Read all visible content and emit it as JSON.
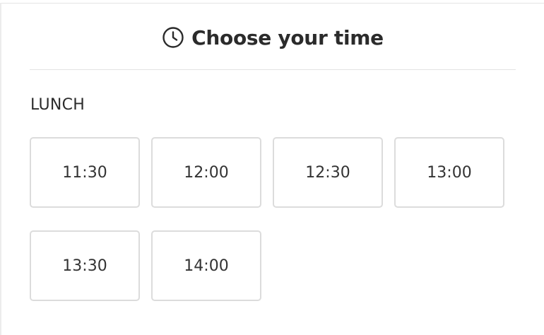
{
  "header": {
    "icon": "clock-icon",
    "title": "Choose your time"
  },
  "section": {
    "label": "LUNCH"
  },
  "slots": [
    {
      "time": "11:30"
    },
    {
      "time": "12:00"
    },
    {
      "time": "12:30"
    },
    {
      "time": "13:00"
    },
    {
      "time": "13:30"
    },
    {
      "time": "14:00"
    }
  ]
}
